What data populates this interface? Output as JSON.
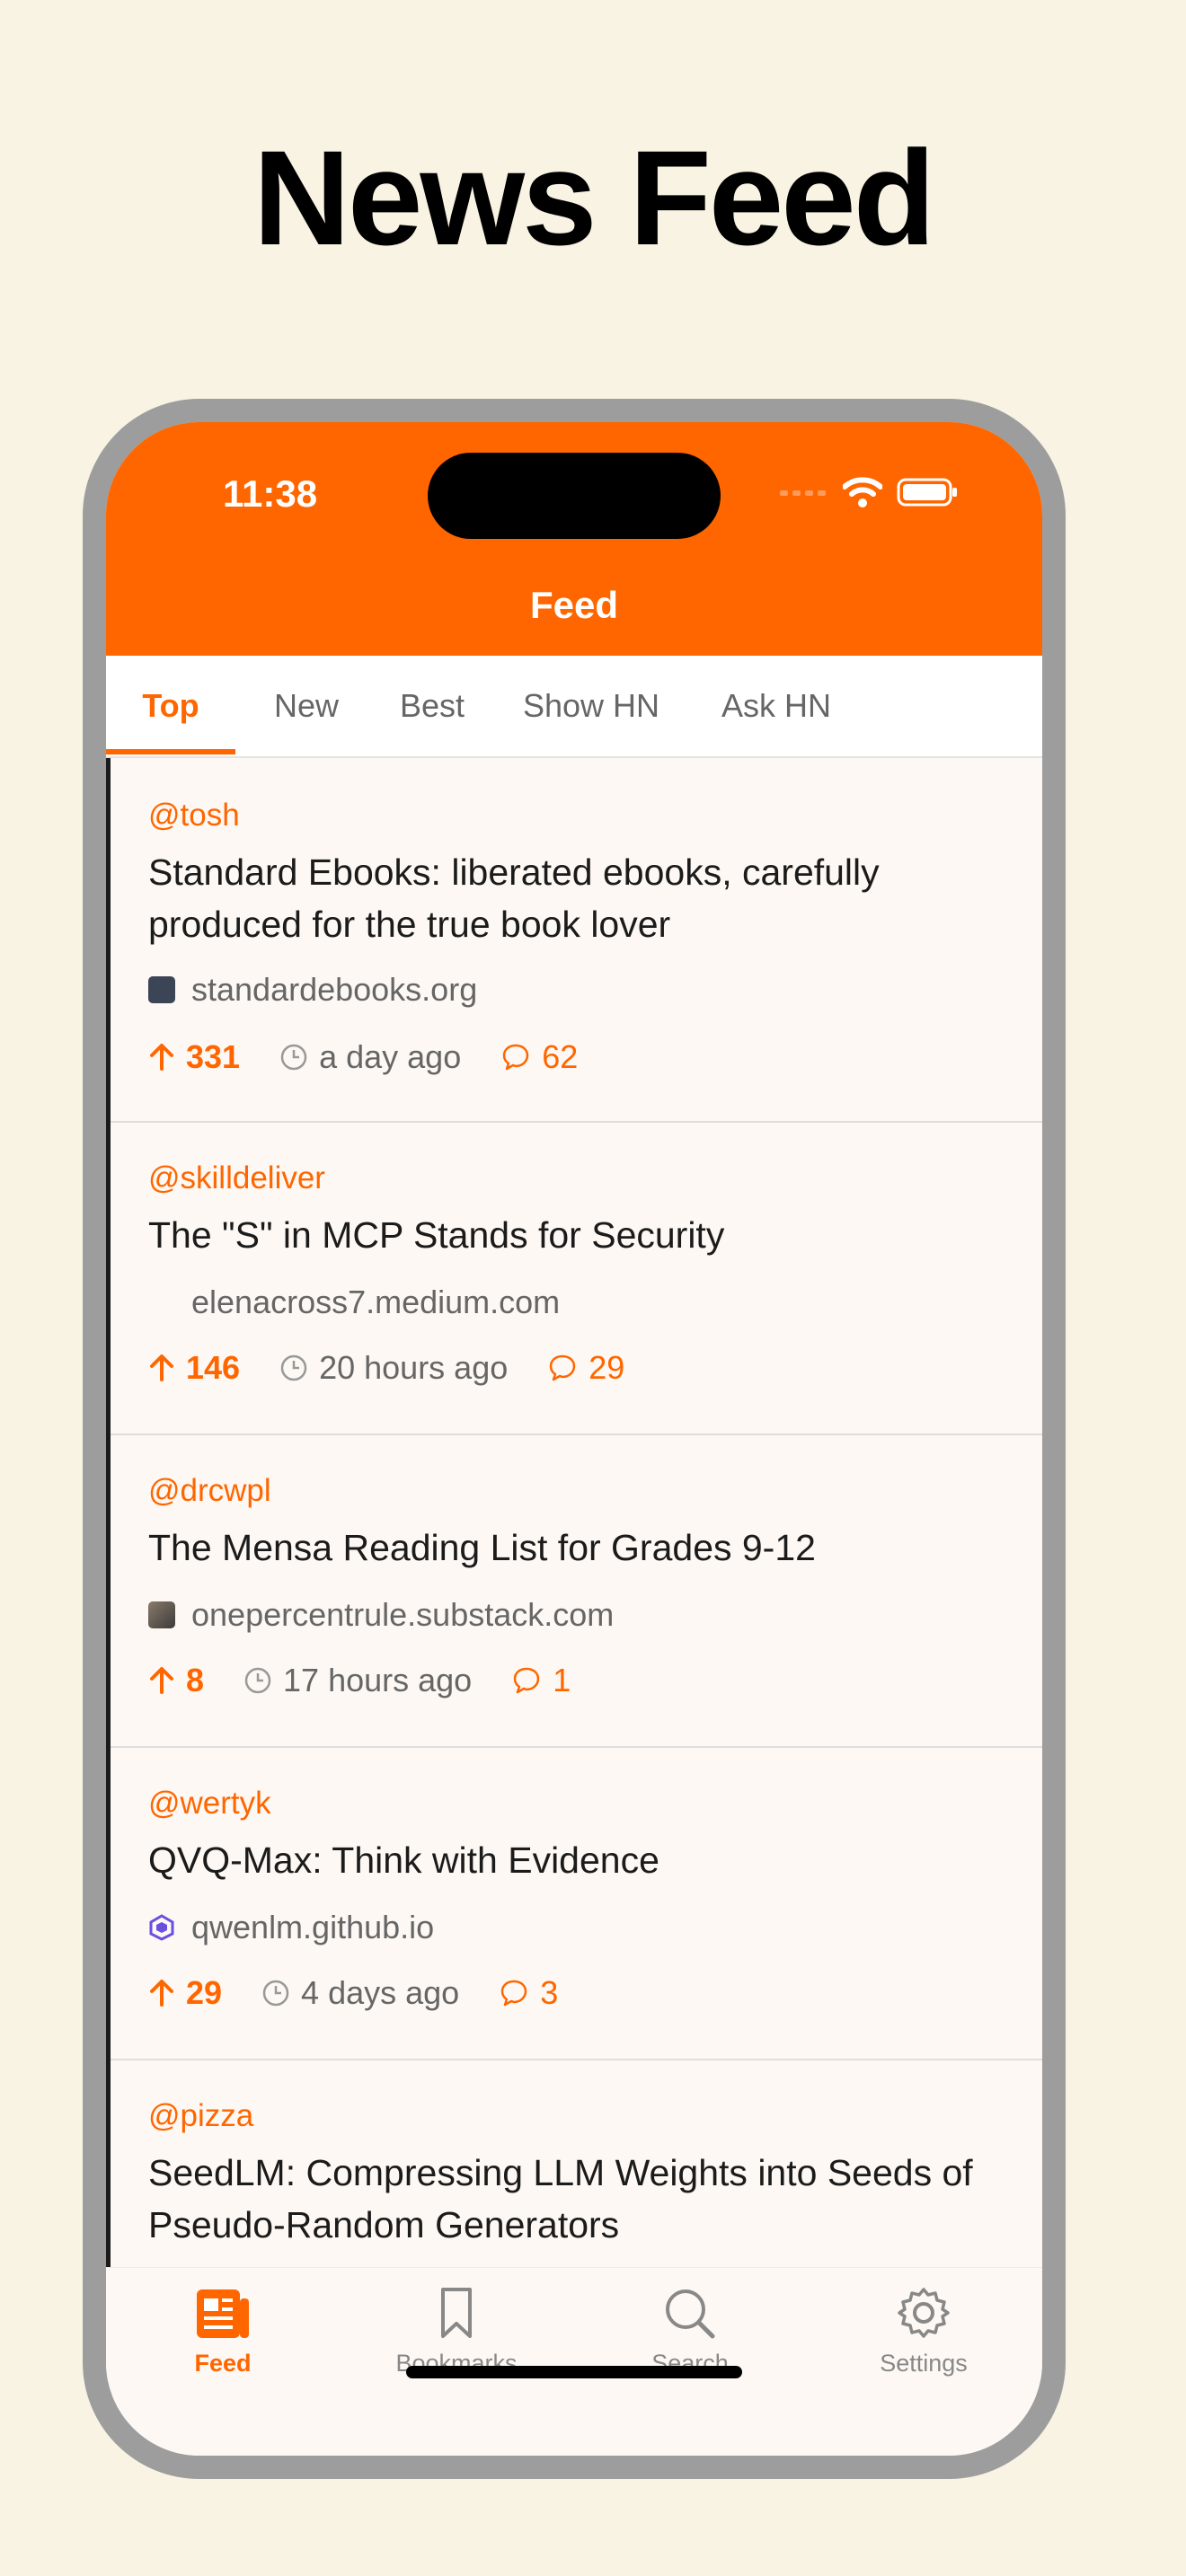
{
  "headline": "News Feed",
  "status_bar": {
    "time": "11:38"
  },
  "nav": {
    "title": "Feed"
  },
  "tabs": [
    {
      "label": "Top",
      "active": true
    },
    {
      "label": "New",
      "active": false
    },
    {
      "label": "Best",
      "active": false
    },
    {
      "label": "Show HN",
      "active": false
    },
    {
      "label": "Ask HN",
      "active": false
    }
  ],
  "stories": [
    {
      "author": "@tosh",
      "title": "Standard Ebooks: liberated ebooks, carefully produced for the true book lover",
      "domain": "standardebooks.org",
      "favicon": "standardebooks-favicon",
      "score": "331",
      "time": "a day ago",
      "comments": "62"
    },
    {
      "author": "@skilldeliver",
      "title": "The \"S\" in MCP Stands for Security",
      "domain": "elenacross7.medium.com",
      "favicon": "",
      "score": "146",
      "time": "20 hours ago",
      "comments": "29"
    },
    {
      "author": "@drcwpl",
      "title": "The Mensa Reading List for Grades 9-12",
      "domain": "onepercentrule.substack.com",
      "favicon": "substack-avatar-favicon",
      "score": "8",
      "time": "17 hours ago",
      "comments": "1"
    },
    {
      "author": "@wertyk",
      "title": "QVQ-Max: Think with Evidence",
      "domain": "qwenlm.github.io",
      "favicon": "qwen-favicon",
      "score": "29",
      "time": "4 days ago",
      "comments": "3"
    },
    {
      "author": "@pizza",
      "title": "SeedLM: Compressing LLM Weights into Seeds of Pseudo-Random Generators",
      "domain": "",
      "favicon": "",
      "score": "",
      "time": "",
      "comments": ""
    }
  ],
  "tabbar": [
    {
      "label": "Feed",
      "icon": "newspaper-icon",
      "active": true
    },
    {
      "label": "Bookmarks",
      "icon": "bookmark-icon",
      "active": false
    },
    {
      "label": "Search",
      "icon": "magnifier-icon",
      "active": false
    },
    {
      "label": "Settings",
      "icon": "gear-icon",
      "active": false
    }
  ],
  "colors": {
    "accent": "#ff6600",
    "background": "#f8f3e2",
    "frame": "#9d9d9d",
    "card": "#fdf8f3"
  }
}
